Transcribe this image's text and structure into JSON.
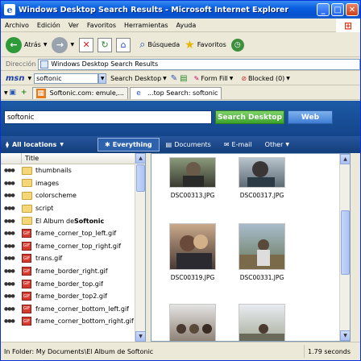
{
  "window": {
    "title": "Windows Desktop Search Results - Microsoft Internet Explorer"
  },
  "menu": [
    "Archivo",
    "Edición",
    "Ver",
    "Favoritos",
    "Herramientas",
    "Ayuda"
  ],
  "toolbar": {
    "back": "Atrás",
    "search": "Búsqueda",
    "favorites": "Favoritos"
  },
  "address": {
    "label": "Dirección",
    "value": "Windows Desktop Search Results"
  },
  "msn": {
    "logo": "msn",
    "input": "softonic",
    "search_desktop": "Search Desktop",
    "form_fill": "Form Fill",
    "blocked": "Blocked (0)"
  },
  "tabs": [
    {
      "label": "Softonic.com: emule,..."
    },
    {
      "label": "...top Search: softonic"
    }
  ],
  "search": {
    "query": "softonic",
    "button": "Search Desktop",
    "web": "Web"
  },
  "filters": {
    "locations": "All locations",
    "everything": "Everything",
    "documents": "Documents",
    "email": "E-mail",
    "other": "Other"
  },
  "list": {
    "header": "Title",
    "rows": [
      {
        "name": "thumbnails",
        "type": "folder"
      },
      {
        "name": "images",
        "type": "folder"
      },
      {
        "name": "colorscheme",
        "type": "folder"
      },
      {
        "name": "script",
        "type": "folder"
      },
      {
        "name": "El Album de ",
        "bold": "Softonic",
        "type": "folder"
      },
      {
        "name": "frame_corner_top_left.gif",
        "type": "gif"
      },
      {
        "name": "frame_corner_top_right.gif",
        "type": "gif"
      },
      {
        "name": "trans.gif",
        "type": "gif"
      },
      {
        "name": "frame_border_right.gif",
        "type": "gif"
      },
      {
        "name": "frame_border_top.gif",
        "type": "gif"
      },
      {
        "name": "frame_border_top2.gif",
        "type": "gif"
      },
      {
        "name": "frame_corner_bottom_left.gif",
        "type": "gif"
      },
      {
        "name": "frame_corner_bottom_right.gif",
        "type": "gif"
      }
    ]
  },
  "photos": [
    "DSC00313.JPG",
    "DSC00317.JPG",
    "DSC00319.JPG",
    "DSC00331.JPG"
  ],
  "status": {
    "folder": "In Folder:  My Documents\\El Album de Softonic",
    "time": "1.79 seconds"
  }
}
